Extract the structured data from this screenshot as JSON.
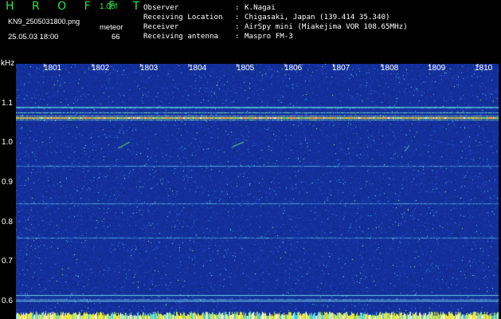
{
  "header": {
    "title": "H R O F F T",
    "version": "1.00f",
    "filename": "KN9_2505031800.png",
    "meteor_label": "meteor",
    "datetime": "25.05.03 18:00",
    "meteor_count": "66"
  },
  "info": [
    {
      "key": "Observer",
      "value": "K.Nagai"
    },
    {
      "key": "Receiving Location",
      "value": "Chigasaki, Japan (139.414 35.340)"
    },
    {
      "key": "Receiver",
      "value": "AirSpy mini (Miakejima VOR 108.65MHz)"
    },
    {
      "key": "Receiving antenna",
      "value": "Maspro FM-3"
    }
  ],
  "axis": {
    "unit": "kHz",
    "y_ticks": [
      "1.1",
      "1.0",
      "0.9",
      "0.8",
      "0.7",
      "0.6"
    ],
    "x_ticks": [
      "1801",
      "1802",
      "1803",
      "1804",
      "1805",
      "1806",
      "1807",
      "1808",
      "1809",
      "1810"
    ]
  },
  "colors": {
    "background": "#000000",
    "spectrogram": "#13309a",
    "title": "#33e04a"
  }
}
